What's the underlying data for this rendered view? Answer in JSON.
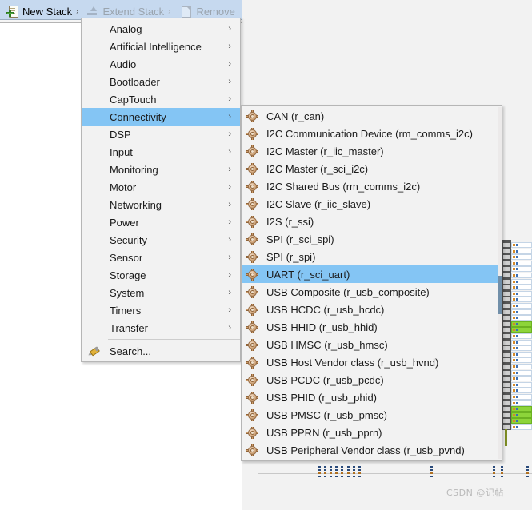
{
  "toolbar": {
    "new_stack": {
      "label": "New Stack",
      "arrow": "›",
      "icon": "new-stack-icon",
      "enabled": true
    },
    "extend_stack": {
      "label": "Extend Stack",
      "arrow": "›",
      "icon": "extend-stack-icon",
      "enabled": false
    },
    "remove": {
      "label": "Remove",
      "icon": "remove-icon",
      "enabled": false
    }
  },
  "category_menu": {
    "selected": "Connectivity",
    "submenu_arrow": "›",
    "items": [
      {
        "label": "Analog",
        "has_submenu": true
      },
      {
        "label": "Artificial Intelligence",
        "has_submenu": true
      },
      {
        "label": "Audio",
        "has_submenu": true
      },
      {
        "label": "Bootloader",
        "has_submenu": true
      },
      {
        "label": "CapTouch",
        "has_submenu": true
      },
      {
        "label": "Connectivity",
        "has_submenu": true
      },
      {
        "label": "DSP",
        "has_submenu": true
      },
      {
        "label": "Input",
        "has_submenu": true
      },
      {
        "label": "Monitoring",
        "has_submenu": true
      },
      {
        "label": "Motor",
        "has_submenu": true
      },
      {
        "label": "Networking",
        "has_submenu": true
      },
      {
        "label": "Power",
        "has_submenu": true
      },
      {
        "label": "Security",
        "has_submenu": true
      },
      {
        "label": "Sensor",
        "has_submenu": true
      },
      {
        "label": "Storage",
        "has_submenu": true
      },
      {
        "label": "System",
        "has_submenu": true
      },
      {
        "label": "Timers",
        "has_submenu": true
      },
      {
        "label": "Transfer",
        "has_submenu": true
      }
    ],
    "search": {
      "label": "Search...",
      "icon": "search-icon"
    }
  },
  "module_menu": {
    "selected": "UART (r_sci_uart)",
    "item_icon": "module-icon",
    "items": [
      {
        "label": "CAN (r_can)"
      },
      {
        "label": "I2C Communication Device (rm_comms_i2c)"
      },
      {
        "label": "I2C Master (r_iic_master)"
      },
      {
        "label": "I2C Master (r_sci_i2c)"
      },
      {
        "label": "I2C Shared Bus (rm_comms_i2c)"
      },
      {
        "label": "I2C Slave (r_iic_slave)"
      },
      {
        "label": "I2S (r_ssi)"
      },
      {
        "label": "SPI (r_sci_spi)"
      },
      {
        "label": "SPI (r_spi)"
      },
      {
        "label": "UART (r_sci_uart)"
      },
      {
        "label": "USB Composite (r_usb_composite)"
      },
      {
        "label": "USB HCDC (r_usb_hcdc)"
      },
      {
        "label": "USB HHID (r_usb_hhid)"
      },
      {
        "label": "USB HMSC (r_usb_hmsc)"
      },
      {
        "label": "USB Host Vendor class (r_usb_hvnd)"
      },
      {
        "label": "USB PCDC (r_usb_pcdc)"
      },
      {
        "label": "USB PHID (r_usb_phid)"
      },
      {
        "label": "USB PMSC (r_usb_pmsc)"
      },
      {
        "label": "USB PPRN (r_usb_pprn)"
      },
      {
        "label": "USB Peripheral Vendor class (r_usb_pvnd)"
      }
    ]
  },
  "watermark": {
    "text": "CSDN @记帖"
  },
  "colors": {
    "menu_background": "#f2f2f2",
    "menu_border": "#b6b6b6",
    "selection": "#84c5f4",
    "panel_header": "#c6d9ef",
    "module_icon": "#c99a6a",
    "pin_active": "#8dd43a",
    "chip_outline": "#4a7ebb",
    "watermark": "#b9b9b9"
  }
}
